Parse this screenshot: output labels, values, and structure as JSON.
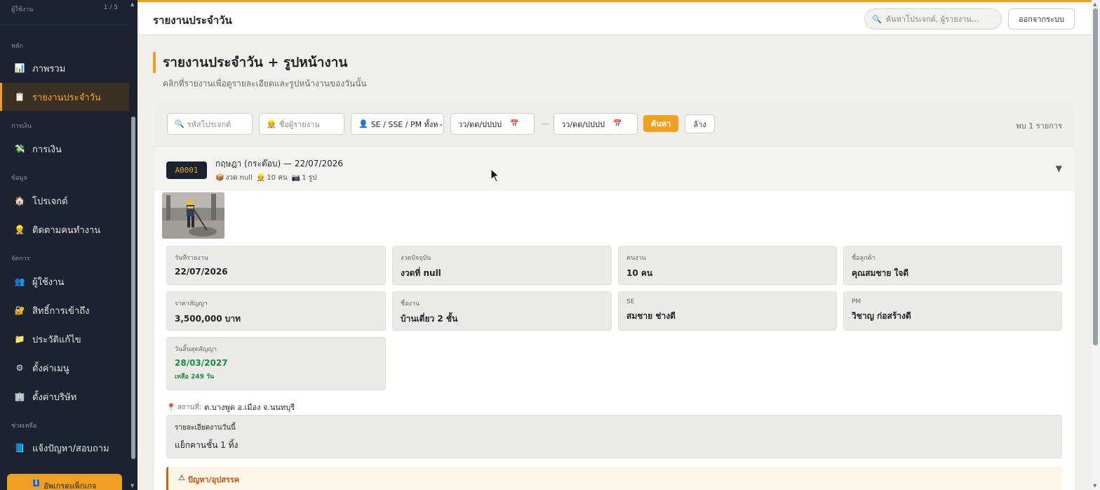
{
  "sidebar": {
    "user_label": "ผู้ใช้งาน",
    "user_count": "1 / 5",
    "sections": {
      "main": "หลัก",
      "finance": "การเงิน",
      "data": "ข้อมูล",
      "manage": "จัดการ",
      "help": "ช่วยเหลือ"
    },
    "items": [
      {
        "label": "ภาพรวม",
        "icon": "📊"
      },
      {
        "label": "รายงานประจำวัน",
        "icon": "📋"
      },
      {
        "label": "การเงิน",
        "icon": "💸"
      },
      {
        "label": "โปรเจกต์",
        "icon": "🏠"
      },
      {
        "label": "ติดตามคนทำงาน",
        "icon": "👷"
      },
      {
        "label": "ผู้ใช้งาน",
        "icon": "👥"
      },
      {
        "label": "สิทธิ์การเข้าถึง",
        "icon": "🔐"
      },
      {
        "label": "ประวัติแก้ไข",
        "icon": "📁"
      },
      {
        "label": "ตั้งค่าเมนู",
        "icon": "⚙"
      },
      {
        "label": "ตั้งค่าบริษัท",
        "icon": "🏢"
      },
      {
        "label": "แจ้งปัญหา/สอบถาม",
        "icon": "📘"
      }
    ],
    "upgrade": "อัพเกรดแพ็กเกจ",
    "upgrade_icon": "ℹ"
  },
  "topbar": {
    "title": "รายงานประจำวัน",
    "search_placeholder": "ค้นหาโปรเจกต์, ผู้รายงาน...",
    "logout": "ออกจากระบบ"
  },
  "page": {
    "heading": "รายงานประจำวัน + รูปหน้างาน",
    "subheading": "คลิกที่รายงานเพื่อดูรายละเอียดและรูปหน้างานของวันนั้น"
  },
  "filters": {
    "project_code": "รหัสโปรเจกต์",
    "reporter": "ชื่อผู้รายงาน",
    "role": "SE / SSE / PM ทั้งห",
    "date_from": "วว/ดด/ปปปป",
    "date_to": "วว/ดด/ปปปป",
    "separator": "—",
    "search_btn": "ค้นหา",
    "clear_btn": "ล้าง",
    "found": "พบ 1 รายการ"
  },
  "report": {
    "code": "A0001",
    "title": "กฤษฎา (กระต๊อบ) — 22/07/2026",
    "meta_installment": "งวด null",
    "meta_workers": "10 คน",
    "meta_photos": "1 รูป",
    "fields": [
      {
        "label": "วันที่รายงาน",
        "value": "22/07/2026"
      },
      {
        "label": "งวดปัจจุบัน",
        "value": "งวดที่ null"
      },
      {
        "label": "คนงาน",
        "value": "10 คน"
      },
      {
        "label": "ชื่อลูกค้า",
        "value": "คุณสมชาย ใจดี"
      },
      {
        "label": "ราคาสัญญา",
        "value": "3,500,000 บาท"
      },
      {
        "label": "ชื่องาน",
        "value": "บ้านเดี่ยว 2 ชั้น"
      },
      {
        "label": "SE",
        "value": "สมชาย ช่างดี"
      },
      {
        "label": "PM",
        "value": "วิชาญ ก่อสร้างดี"
      }
    ],
    "contract_end": {
      "label": "วันสิ้นสุดสัญญา",
      "value": "28/03/2027",
      "remaining": "เหลือ 249 วัน"
    },
    "location_label": "สถานที่:",
    "location": "ต.บางพูด อ.เมือง จ.นนทบุรี",
    "detail_label": "รายละเอียดงานวันนี้",
    "detail": "แย็กคานชั้น 1 ทิ้ง",
    "problem_label": "ปัญหา/อุปสรรค"
  },
  "colors": {
    "accent": "#f0a020",
    "sidebar_bg": "#1b2330",
    "green": "#1a8a4a"
  }
}
